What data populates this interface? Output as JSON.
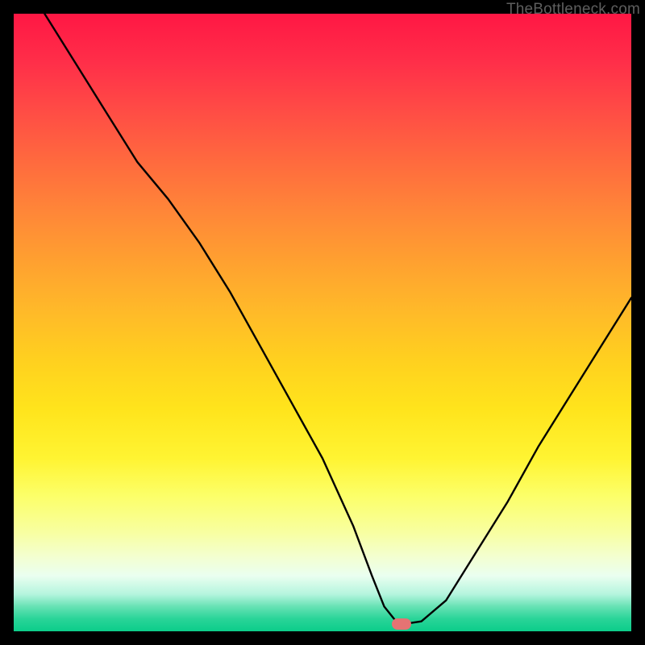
{
  "watermark": "TheBottleneck.com",
  "marker": {
    "x_frac": 0.628,
    "y_frac": 0.988
  },
  "chart_data": {
    "type": "line",
    "title": "",
    "xlabel": "",
    "ylabel": "",
    "xlim": [
      0,
      100
    ],
    "ylim": [
      0,
      100
    ],
    "grid": false,
    "legend": false,
    "series": [
      {
        "name": "bottleneck-curve",
        "x": [
          5,
          10,
          15,
          20,
          25,
          30,
          35,
          40,
          45,
          50,
          55,
          58,
          60,
          62,
          64,
          66,
          70,
          75,
          80,
          85,
          90,
          95,
          100
        ],
        "y": [
          100,
          92,
          84,
          76,
          70,
          63,
          55,
          46,
          37,
          28,
          17,
          9,
          4,
          1.5,
          1.3,
          1.6,
          5,
          13,
          21,
          30,
          38,
          46,
          54
        ]
      }
    ],
    "annotations": [
      {
        "type": "marker",
        "shape": "pill",
        "color": "#e57373",
        "x": 62.8,
        "y": 1.2
      }
    ],
    "background": {
      "type": "vertical-gradient",
      "stops": [
        {
          "pos": 0.0,
          "color": "#ff1744"
        },
        {
          "pos": 0.5,
          "color": "#ffca1f"
        },
        {
          "pos": 0.8,
          "color": "#fcff80"
        },
        {
          "pos": 1.0,
          "color": "#0ccd8a"
        }
      ]
    }
  }
}
